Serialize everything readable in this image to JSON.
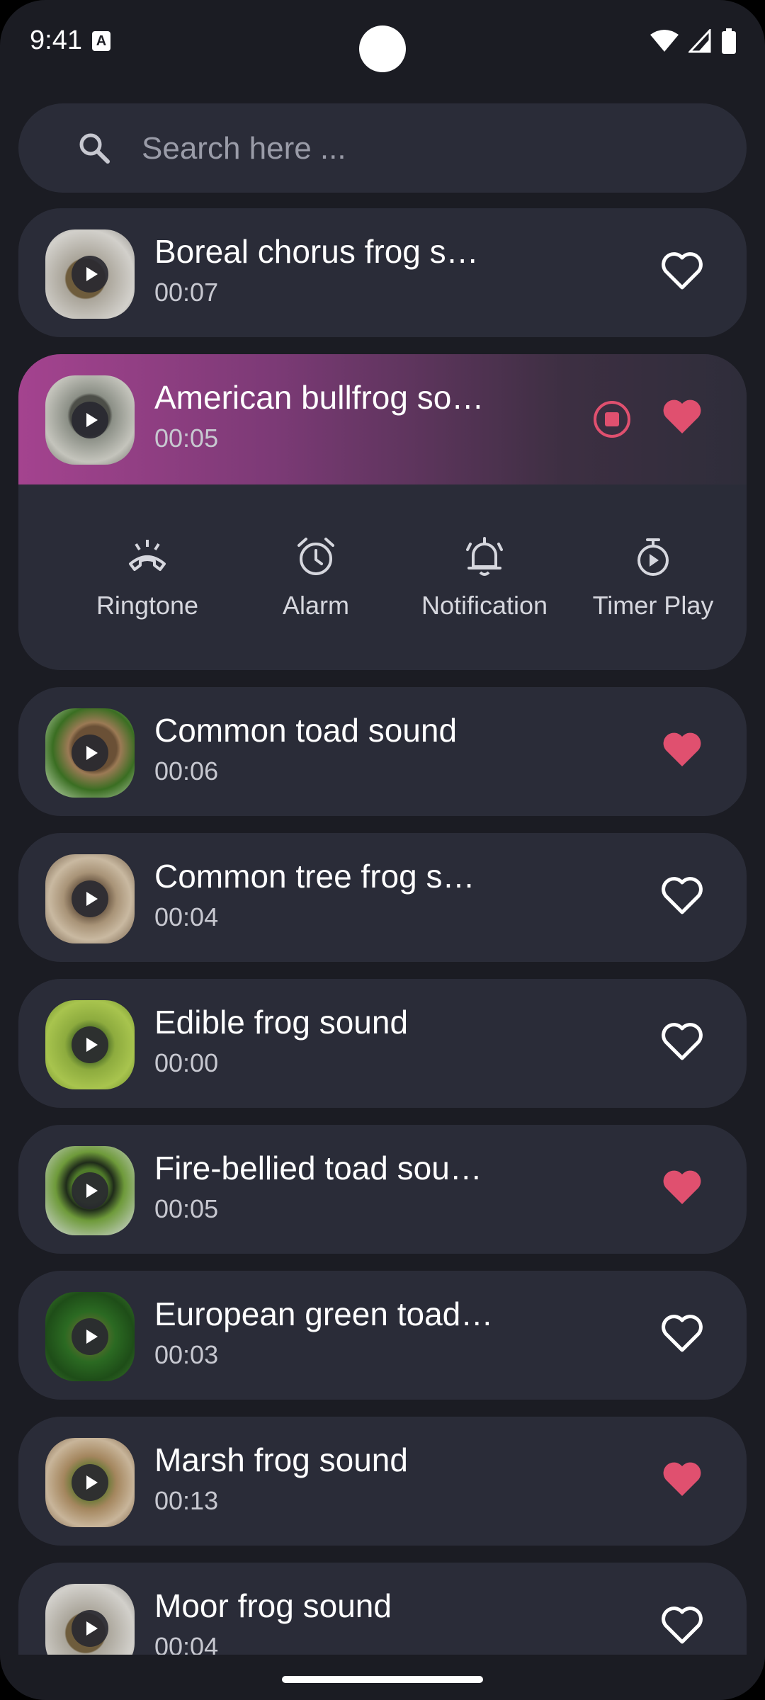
{
  "status_bar": {
    "time": "9:41",
    "badge": "A"
  },
  "search": {
    "placeholder": "Search here ..."
  },
  "colors": {
    "accent": "#e0506f",
    "card": "#2a2c38",
    "background": "#1b1c23"
  },
  "sounds": [
    {
      "title": "Boreal chorus frog s…",
      "duration": "00:07",
      "favorite": false
    },
    {
      "title": "American bullfrog so…",
      "duration": "00:05",
      "favorite": true,
      "playing": true
    },
    {
      "title": "Common toad sound",
      "duration": "00:06",
      "favorite": true
    },
    {
      "title": "Common tree frog s…",
      "duration": "00:04",
      "favorite": false
    },
    {
      "title": "Edible frog sound",
      "duration": "00:00",
      "favorite": false
    },
    {
      "title": "Fire-bellied toad sou…",
      "duration": "00:05",
      "favorite": true
    },
    {
      "title": "European green toad…",
      "duration": "00:03",
      "favorite": false
    },
    {
      "title": "Marsh frog sound",
      "duration": "00:13",
      "favorite": true
    },
    {
      "title": "Moor frog sound",
      "duration": "00:04",
      "favorite": false
    }
  ],
  "actions": [
    {
      "label": "Ringtone",
      "icon": "ringtone-icon"
    },
    {
      "label": "Alarm",
      "icon": "alarm-icon"
    },
    {
      "label": "Notification",
      "icon": "notification-icon"
    },
    {
      "label": "Timer Play",
      "icon": "timer-play-icon"
    }
  ]
}
